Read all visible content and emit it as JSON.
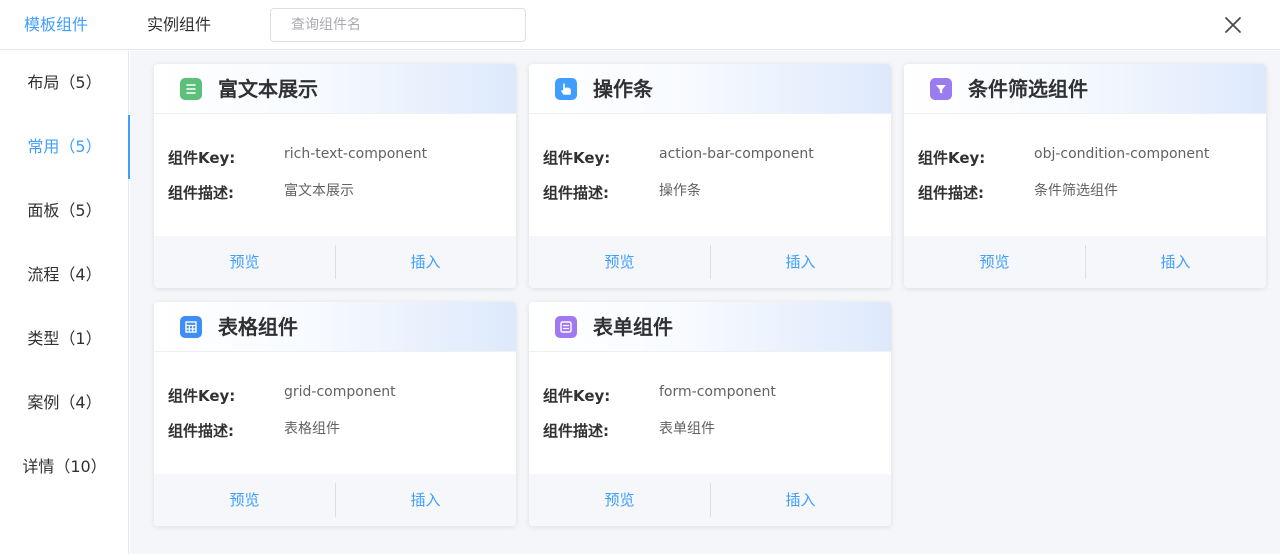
{
  "header": {
    "tabs": [
      {
        "label": "模板组件",
        "active": true
      },
      {
        "label": "实例组件",
        "active": false
      }
    ],
    "search_placeholder": "查询组件名",
    "close_icon": "close-icon"
  },
  "sidebar": {
    "items": [
      {
        "label": "布局（5）",
        "active": false
      },
      {
        "label": "常用（5）",
        "active": true
      },
      {
        "label": "面板（5）",
        "active": false
      },
      {
        "label": "流程（4）",
        "active": false
      },
      {
        "label": "类型（1）",
        "active": false
      },
      {
        "label": "案例（4）",
        "active": false
      },
      {
        "label": "详情（10）",
        "active": false
      }
    ]
  },
  "cards": [
    {
      "title": "富文本展示",
      "icon": "rich-text-icon",
      "icon_color": "#5cbf7a",
      "key_label": "组件Key:",
      "key_value": "rich-text-component",
      "desc_label": "组件描述:",
      "desc_value": "富文本展示",
      "preview": "预览",
      "insert": "插入"
    },
    {
      "title": "操作条",
      "icon": "action-bar-icon",
      "icon_color": "#409eff",
      "key_label": "组件Key:",
      "key_value": "action-bar-component",
      "desc_label": "组件描述:",
      "desc_value": "操作条",
      "preview": "预览",
      "insert": "插入"
    },
    {
      "title": "条件筛选组件",
      "icon": "filter-icon",
      "icon_color": "#9b7bf0",
      "key_label": "组件Key:",
      "key_value": "obj-condition-component",
      "desc_label": "组件描述:",
      "desc_value": "条件筛选组件",
      "preview": "预览",
      "insert": "插入"
    },
    {
      "title": "表格组件",
      "icon": "table-icon",
      "icon_color": "#3d8ef5",
      "key_label": "组件Key:",
      "key_value": "grid-component",
      "desc_label": "组件描述:",
      "desc_value": "表格组件",
      "preview": "预览",
      "insert": "插入"
    },
    {
      "title": "表单组件",
      "icon": "form-icon",
      "icon_color": "#a078ef",
      "key_label": "组件Key:",
      "key_value": "form-component",
      "desc_label": "组件描述:",
      "desc_value": "表单组件",
      "preview": "预览",
      "insert": "插入"
    }
  ]
}
